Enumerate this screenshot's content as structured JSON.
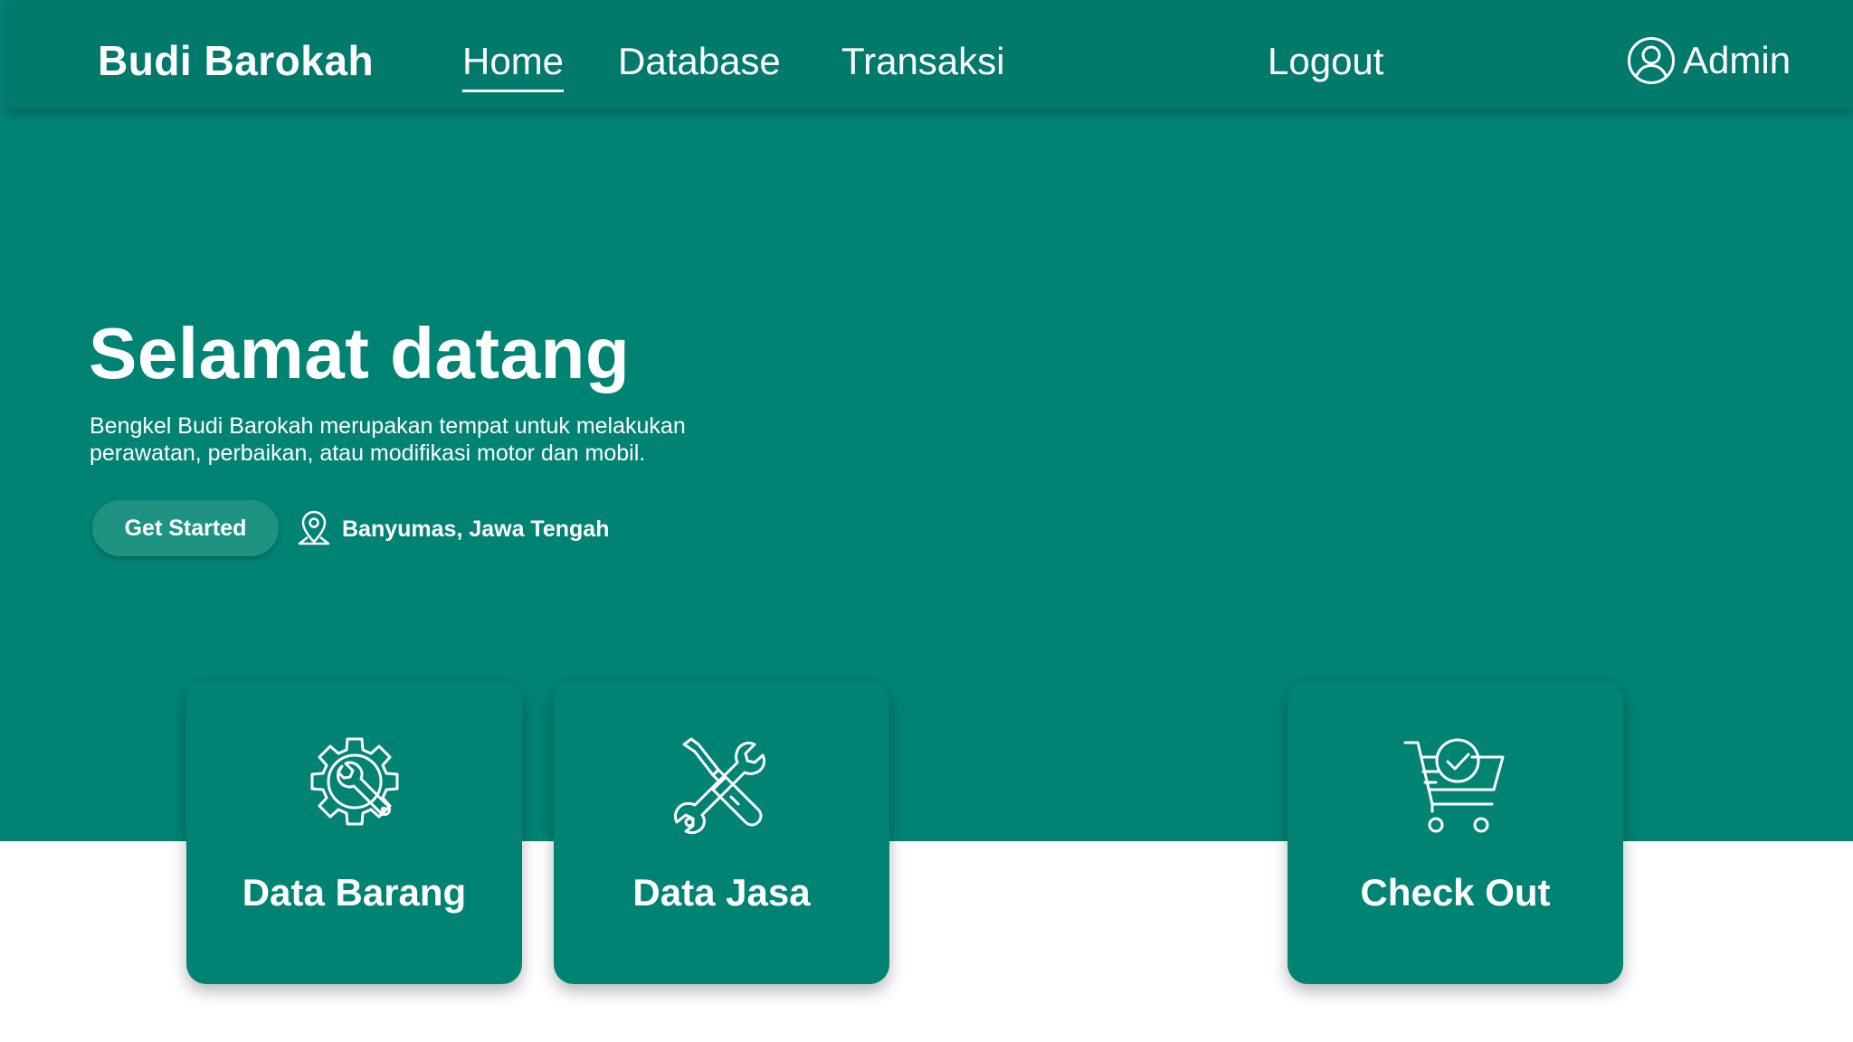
{
  "brand": "Budi Barokah",
  "nav": {
    "home": "Home",
    "database": "Database",
    "transaksi": "Transaksi",
    "logout": "Logout",
    "admin": "Admin"
  },
  "hero": {
    "title": "Selamat datang",
    "description": "Bengkel Budi Barokah merupakan tempat untuk melakukan perawatan, perbaikan, atau modifikasi motor dan mobil.",
    "cta": "Get Started",
    "location": "Banyumas, Jawa Tengah"
  },
  "cards": [
    {
      "label": "Data Barang",
      "icon": "gear-wrench-icon"
    },
    {
      "label": "Data Jasa",
      "icon": "tools-icon"
    },
    {
      "label": "Check Out",
      "icon": "cart-check-icon"
    }
  ],
  "colors": {
    "primary": "#018373",
    "navbar": "#017a6c",
    "button": "#1e9382",
    "text": "#ffffff",
    "background": "#ffffff"
  }
}
